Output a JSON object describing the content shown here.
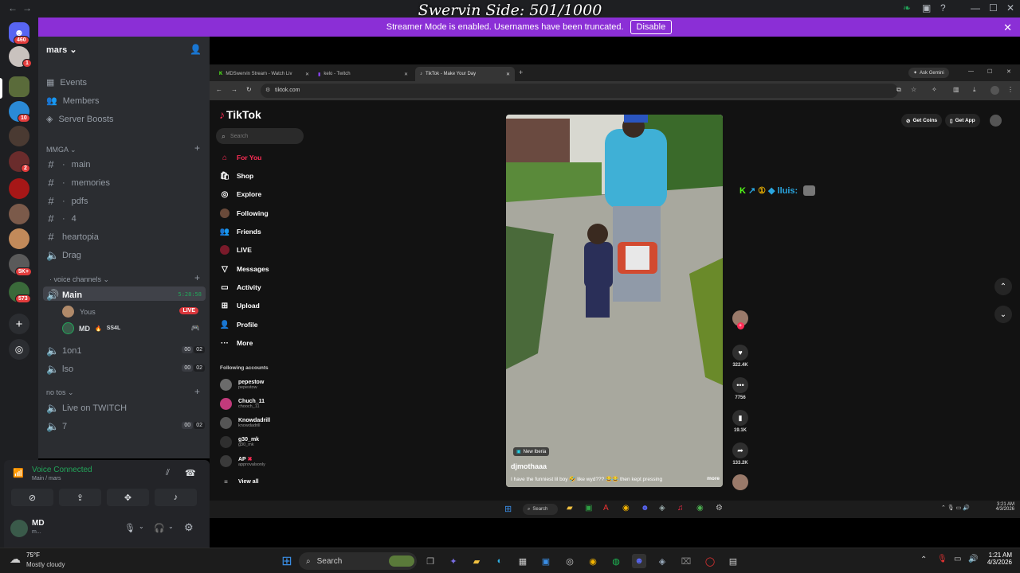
{
  "overlay_title": "Swervin Side: 501/1000",
  "titlebar": {
    "snip": "Share"
  },
  "banner": {
    "text": "Streamer Mode is enabled. Usernames have been truncated.",
    "button": "Disable"
  },
  "rail": {
    "badges": [
      "460",
      "1",
      "10",
      "2",
      "5K+",
      "573"
    ]
  },
  "server": {
    "name": "mars",
    "quick_links": [
      "Events",
      "Members",
      "Server Boosts"
    ],
    "categories": [
      {
        "name": "MMGA",
        "channels": [
          "main",
          "memories",
          "pdfs",
          "4",
          "heartopia",
          "Drag"
        ]
      },
      {
        "name": "voice channels"
      },
      {
        "name": "no tos"
      }
    ],
    "voice": {
      "active_name": "Main",
      "timer": "5:28:58",
      "members": [
        {
          "name": "Yous",
          "badge": "LIVE"
        },
        {
          "name": "MD",
          "tag": "SS4L"
        }
      ],
      "others": [
        {
          "name": "1on1",
          "counts": [
            "00",
            "02"
          ]
        },
        {
          "name": "lso",
          "counts": [
            "00",
            "02"
          ]
        }
      ]
    },
    "no_tos": [
      {
        "name": "Live on TWITCH"
      },
      {
        "name": "7",
        "counts": [
          "00",
          "02"
        ]
      }
    ]
  },
  "voice_panel": {
    "status": "Voice Connected",
    "location": "Main / mars"
  },
  "user_panel": {
    "name": "MD",
    "sub": "m..."
  },
  "browser": {
    "tabs": [
      "MDSwervin Stream - Watch Liv",
      "kelo - Twitch",
      "TikTok - Make Your Day"
    ],
    "gemini": "Ask Gemini",
    "url": "tiktok.com"
  },
  "tiktok": {
    "logo": "TikTok",
    "search_placeholder": "Search",
    "nav": [
      "For You",
      "Shop",
      "Explore",
      "Following",
      "Friends",
      "LIVE",
      "Messages",
      "Activity",
      "Upload",
      "Profile",
      "More"
    ],
    "following_title": "Following accounts",
    "accounts": [
      {
        "name": "pepestow",
        "handle": "pepestow",
        "color": "#6b6b6b"
      },
      {
        "name": "Chuch_11",
        "handle": "chooch_11",
        "color": "#c23a7b"
      },
      {
        "name": "Knowdadrill",
        "handle": "knowdadrill",
        "color": "#555555"
      },
      {
        "name": "g30_mk",
        "handle": "g30_mk",
        "color": "#2f2f2f"
      },
      {
        "name": "AP",
        "handle": "approvalsonly",
        "color": "#3a3a3a"
      }
    ],
    "view_all": "View all",
    "get_coins": "Get Coins",
    "get_app": "Get App",
    "chat_line": "lluis:",
    "video": {
      "location": "New Iberia",
      "author": "djmothaaa",
      "caption": "I have the funniest lil boy 🤣 like wyd??? 😂😂 then kept pressing",
      "more": "more"
    },
    "actions": [
      "322.4K",
      "7756",
      "19.1K",
      "133.2K"
    ]
  },
  "inner_taskbar": {
    "search": "Search",
    "time": "3:21 AM",
    "date": "4/3/2026"
  },
  "taskbar": {
    "weather_temp": "75°F",
    "weather_desc": "Mostly cloudy",
    "search": "Search",
    "time": "1:21 AM",
    "date": "4/3/2026"
  }
}
